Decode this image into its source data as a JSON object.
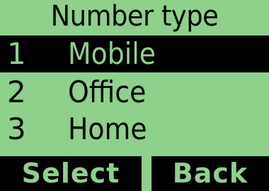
{
  "screen": {
    "title": "Number type",
    "colors": {
      "background": "#8ed18b",
      "foreground": "#000000"
    },
    "menu": {
      "items": [
        {
          "number": "1",
          "label": "Mobile",
          "selected": true
        },
        {
          "number": "2",
          "label": "Office",
          "selected": false
        },
        {
          "number": "3",
          "label": "Home",
          "selected": false
        }
      ]
    },
    "softkeys": {
      "left": "Select",
      "right": "Back"
    }
  }
}
